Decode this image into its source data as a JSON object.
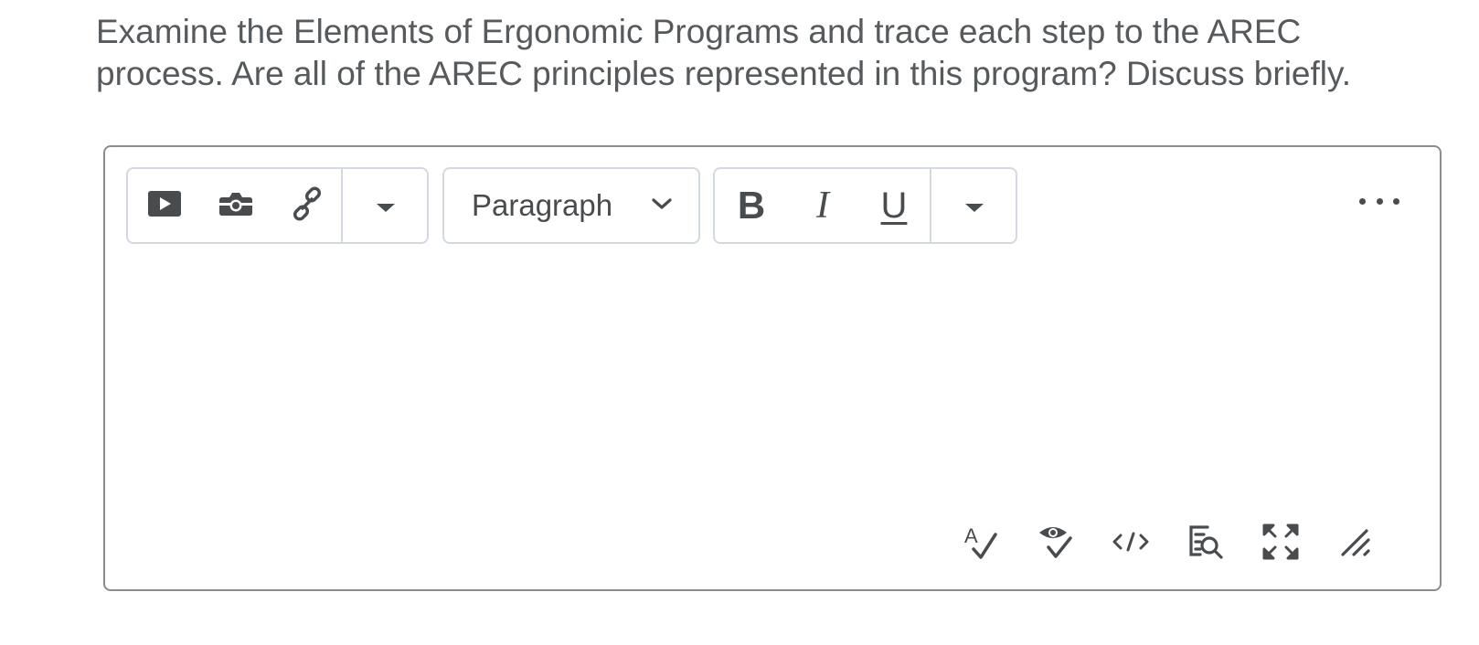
{
  "question": {
    "line1": "Examine the Elements of Ergonomic Programs and trace each step to the AREC",
    "line2": "process.  Are all of the AREC principles represented in this program? Discuss briefly."
  },
  "toolbar": {
    "insert_group": {
      "icons": [
        "video-icon",
        "camera-icon",
        "link-icon",
        "caret-down-icon"
      ]
    },
    "format_select": {
      "selected": "Paragraph",
      "icon": "chevron-down-icon"
    },
    "text_style_group": {
      "bold_label": "B",
      "italic_label": "I",
      "underline_label": "U",
      "icons": [
        "bold-icon",
        "italic-icon",
        "underline-icon",
        "caret-down-icon"
      ]
    },
    "more_icon": "more-horizontal-icon"
  },
  "editor": {
    "content": ""
  },
  "status_bar": {
    "icons": [
      "spellcheck-icon",
      "accessibility-check-icon",
      "source-code-icon",
      "preview-icon",
      "fullscreen-icon",
      "resize-handle-icon"
    ]
  },
  "colors": {
    "text": "#494c4e",
    "border": "#8a8c8e",
    "group_border": "#d3d9e3",
    "background": "#ffffff"
  }
}
